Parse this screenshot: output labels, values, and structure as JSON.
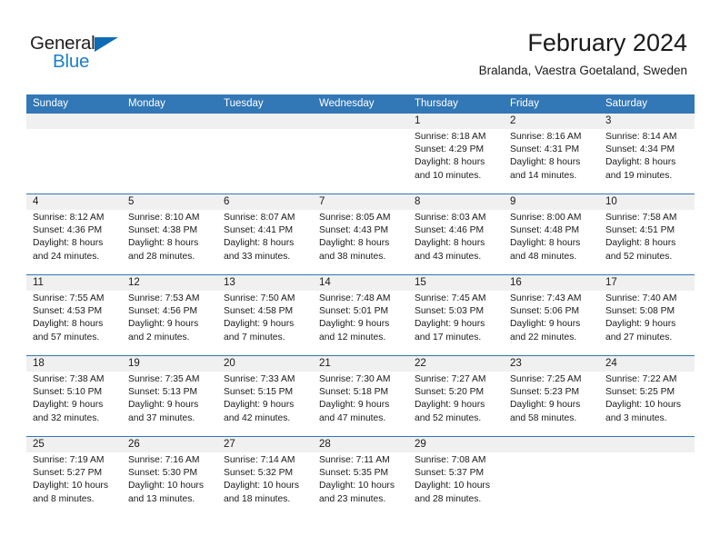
{
  "brand": {
    "logo_text_1": "General",
    "logo_text_2": "Blue",
    "logo_triangle_icon": "triangle-icon",
    "accent_color": "#3277b6",
    "logo_blue": "#1c7fc9",
    "header_bg": "#3277b6",
    "daynum_bg": "#f0f0f0"
  },
  "header": {
    "title": "February 2024",
    "subtitle": "Bralanda, Vaestra Goetaland, Sweden"
  },
  "calendar": {
    "weekdays": [
      "Sunday",
      "Monday",
      "Tuesday",
      "Wednesday",
      "Thursday",
      "Friday",
      "Saturday"
    ],
    "weeks": [
      [
        {
          "day": "",
          "lines": []
        },
        {
          "day": "",
          "lines": []
        },
        {
          "day": "",
          "lines": []
        },
        {
          "day": "",
          "lines": []
        },
        {
          "day": "1",
          "lines": [
            "Sunrise: 8:18 AM",
            "Sunset: 4:29 PM",
            "Daylight: 8 hours",
            "and 10 minutes."
          ]
        },
        {
          "day": "2",
          "lines": [
            "Sunrise: 8:16 AM",
            "Sunset: 4:31 PM",
            "Daylight: 8 hours",
            "and 14 minutes."
          ]
        },
        {
          "day": "3",
          "lines": [
            "Sunrise: 8:14 AM",
            "Sunset: 4:34 PM",
            "Daylight: 8 hours",
            "and 19 minutes."
          ]
        }
      ],
      [
        {
          "day": "4",
          "lines": [
            "Sunrise: 8:12 AM",
            "Sunset: 4:36 PM",
            "Daylight: 8 hours",
            "and 24 minutes."
          ]
        },
        {
          "day": "5",
          "lines": [
            "Sunrise: 8:10 AM",
            "Sunset: 4:38 PM",
            "Daylight: 8 hours",
            "and 28 minutes."
          ]
        },
        {
          "day": "6",
          "lines": [
            "Sunrise: 8:07 AM",
            "Sunset: 4:41 PM",
            "Daylight: 8 hours",
            "and 33 minutes."
          ]
        },
        {
          "day": "7",
          "lines": [
            "Sunrise: 8:05 AM",
            "Sunset: 4:43 PM",
            "Daylight: 8 hours",
            "and 38 minutes."
          ]
        },
        {
          "day": "8",
          "lines": [
            "Sunrise: 8:03 AM",
            "Sunset: 4:46 PM",
            "Daylight: 8 hours",
            "and 43 minutes."
          ]
        },
        {
          "day": "9",
          "lines": [
            "Sunrise: 8:00 AM",
            "Sunset: 4:48 PM",
            "Daylight: 8 hours",
            "and 48 minutes."
          ]
        },
        {
          "day": "10",
          "lines": [
            "Sunrise: 7:58 AM",
            "Sunset: 4:51 PM",
            "Daylight: 8 hours",
            "and 52 minutes."
          ]
        }
      ],
      [
        {
          "day": "11",
          "lines": [
            "Sunrise: 7:55 AM",
            "Sunset: 4:53 PM",
            "Daylight: 8 hours",
            "and 57 minutes."
          ]
        },
        {
          "day": "12",
          "lines": [
            "Sunrise: 7:53 AM",
            "Sunset: 4:56 PM",
            "Daylight: 9 hours",
            "and 2 minutes."
          ]
        },
        {
          "day": "13",
          "lines": [
            "Sunrise: 7:50 AM",
            "Sunset: 4:58 PM",
            "Daylight: 9 hours",
            "and 7 minutes."
          ]
        },
        {
          "day": "14",
          "lines": [
            "Sunrise: 7:48 AM",
            "Sunset: 5:01 PM",
            "Daylight: 9 hours",
            "and 12 minutes."
          ]
        },
        {
          "day": "15",
          "lines": [
            "Sunrise: 7:45 AM",
            "Sunset: 5:03 PM",
            "Daylight: 9 hours",
            "and 17 minutes."
          ]
        },
        {
          "day": "16",
          "lines": [
            "Sunrise: 7:43 AM",
            "Sunset: 5:06 PM",
            "Daylight: 9 hours",
            "and 22 minutes."
          ]
        },
        {
          "day": "17",
          "lines": [
            "Sunrise: 7:40 AM",
            "Sunset: 5:08 PM",
            "Daylight: 9 hours",
            "and 27 minutes."
          ]
        }
      ],
      [
        {
          "day": "18",
          "lines": [
            "Sunrise: 7:38 AM",
            "Sunset: 5:10 PM",
            "Daylight: 9 hours",
            "and 32 minutes."
          ]
        },
        {
          "day": "19",
          "lines": [
            "Sunrise: 7:35 AM",
            "Sunset: 5:13 PM",
            "Daylight: 9 hours",
            "and 37 minutes."
          ]
        },
        {
          "day": "20",
          "lines": [
            "Sunrise: 7:33 AM",
            "Sunset: 5:15 PM",
            "Daylight: 9 hours",
            "and 42 minutes."
          ]
        },
        {
          "day": "21",
          "lines": [
            "Sunrise: 7:30 AM",
            "Sunset: 5:18 PM",
            "Daylight: 9 hours",
            "and 47 minutes."
          ]
        },
        {
          "day": "22",
          "lines": [
            "Sunrise: 7:27 AM",
            "Sunset: 5:20 PM",
            "Daylight: 9 hours",
            "and 52 minutes."
          ]
        },
        {
          "day": "23",
          "lines": [
            "Sunrise: 7:25 AM",
            "Sunset: 5:23 PM",
            "Daylight: 9 hours",
            "and 58 minutes."
          ]
        },
        {
          "day": "24",
          "lines": [
            "Sunrise: 7:22 AM",
            "Sunset: 5:25 PM",
            "Daylight: 10 hours",
            "and 3 minutes."
          ]
        }
      ],
      [
        {
          "day": "25",
          "lines": [
            "Sunrise: 7:19 AM",
            "Sunset: 5:27 PM",
            "Daylight: 10 hours",
            "and 8 minutes."
          ]
        },
        {
          "day": "26",
          "lines": [
            "Sunrise: 7:16 AM",
            "Sunset: 5:30 PM",
            "Daylight: 10 hours",
            "and 13 minutes."
          ]
        },
        {
          "day": "27",
          "lines": [
            "Sunrise: 7:14 AM",
            "Sunset: 5:32 PM",
            "Daylight: 10 hours",
            "and 18 minutes."
          ]
        },
        {
          "day": "28",
          "lines": [
            "Sunrise: 7:11 AM",
            "Sunset: 5:35 PM",
            "Daylight: 10 hours",
            "and 23 minutes."
          ]
        },
        {
          "day": "29",
          "lines": [
            "Sunrise: 7:08 AM",
            "Sunset: 5:37 PM",
            "Daylight: 10 hours",
            "and 28 minutes."
          ]
        },
        {
          "day": "",
          "lines": []
        },
        {
          "day": "",
          "lines": []
        }
      ]
    ]
  }
}
